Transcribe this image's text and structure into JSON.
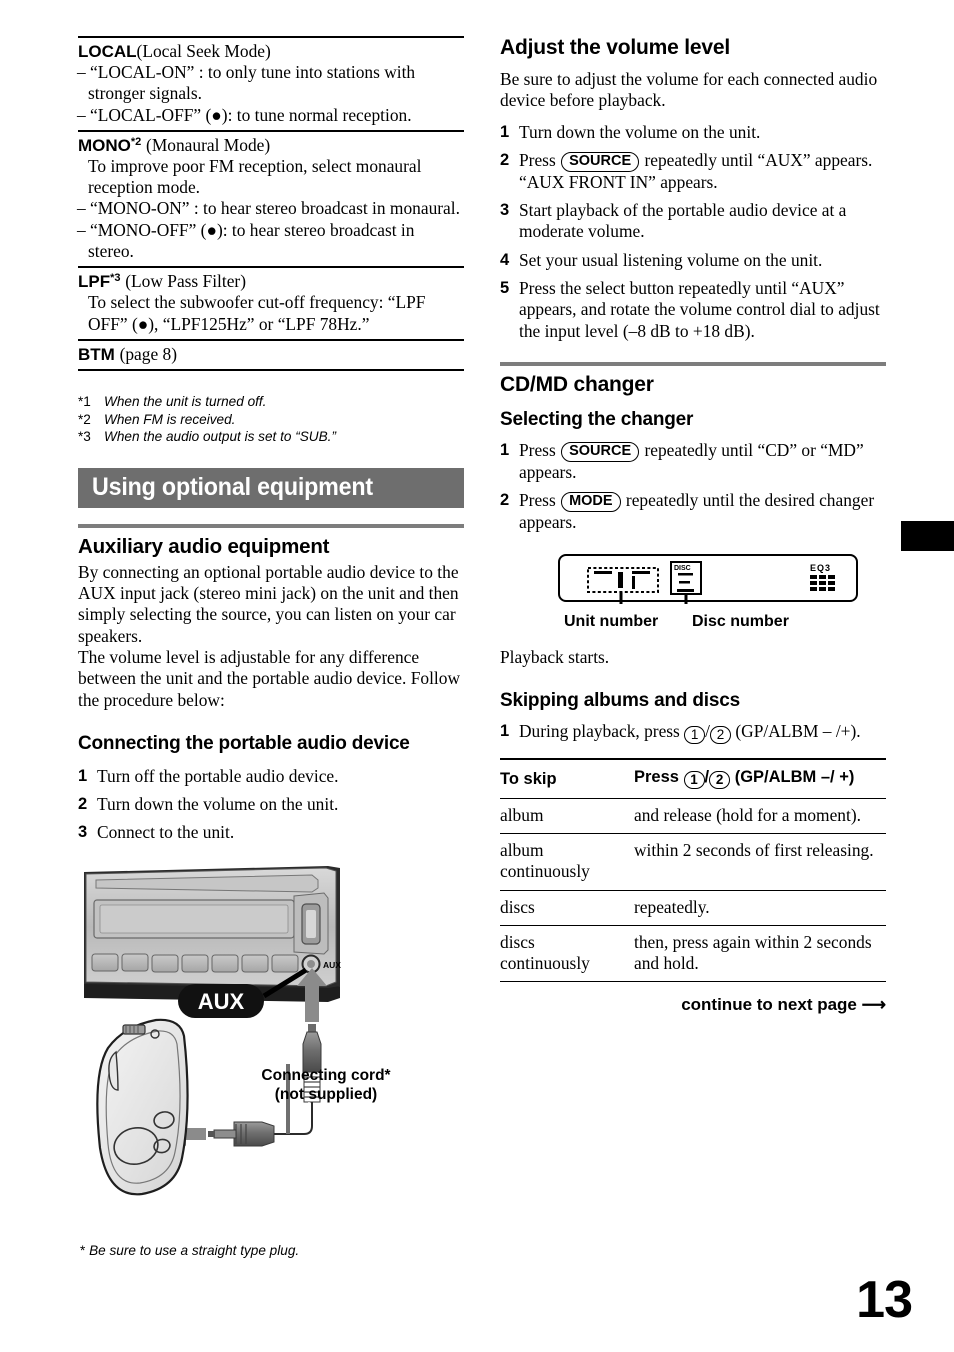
{
  "page_number": "13",
  "left_column": {
    "settings": [
      {
        "name": "LOCAL",
        "sup": "",
        "paren": "(Local Seek Mode)",
        "lines": [
          {
            "type": "dash",
            "text": "– “LOCAL-ON” : to only tune into stations with stronger signals."
          },
          {
            "type": "dash",
            "text": "– “LOCAL-OFF” (●): to tune normal reception."
          }
        ]
      },
      {
        "name": "MONO",
        "sup": "*2",
        "paren": "(Monaural Mode)",
        "lines": [
          {
            "type": "ind",
            "text": "To improve poor FM reception, select monaural reception mode."
          },
          {
            "type": "dash",
            "text": "– “MONO-ON” : to hear stereo broadcast in monaural."
          },
          {
            "type": "dash",
            "text": "– “MONO-OFF” (●): to hear stereo broadcast in stereo."
          }
        ]
      },
      {
        "name": "LPF",
        "sup": "*3",
        "paren": "(Low Pass Filter)",
        "lines": [
          {
            "type": "ind",
            "text": "To select the subwoofer cut-off frequency: “LPF OFF” (●), “LPF125Hz” or “LPF 78Hz.”"
          }
        ]
      },
      {
        "name": "BTM",
        "sup": "",
        "paren": "(page 8)",
        "lines": []
      }
    ],
    "footnotes": [
      {
        "marker": "*1",
        "text": "When the unit is turned off."
      },
      {
        "marker": "*2",
        "text": "When FM is received."
      },
      {
        "marker": "*3",
        "text": "When the audio output is set to “SUB.”"
      }
    ],
    "banner_title": "Using optional equipment",
    "aux_heading": "Auxiliary audio equipment",
    "aux_paragraph_1": "By connecting an optional portable audio device to the AUX input jack (stereo mini jack) on the unit and then simply selecting the source, you can listen on your car speakers.",
    "aux_paragraph_2": "The volume level is adjustable for any difference between the unit and the portable audio device. Follow the procedure below:",
    "connect_heading": "Connecting the portable audio device",
    "connect_steps": [
      {
        "n": "1",
        "text": "Turn off the portable audio device."
      },
      {
        "n": "2",
        "text": "Turn down the volume on the unit."
      },
      {
        "n": "3",
        "text": "Connect to the unit."
      }
    ],
    "figure": {
      "aux_badge": "AUX",
      "aux_port_label": "AUX",
      "cord_label_line1": "Connecting cord*",
      "cord_label_line2": "(not supplied)"
    },
    "bottom_note_marker": "*",
    "bottom_note_text": "Be sure to use a straight type plug."
  },
  "right_column": {
    "volume_heading": "Adjust the volume level",
    "volume_intro": "Be sure to adjust the volume for each connected audio device before playback.",
    "volume_steps": [
      {
        "n": "1",
        "pre": "Turn down the volume on the unit.",
        "key": "",
        "post": ""
      },
      {
        "n": "2",
        "pre": "Press ",
        "key": "SOURCE",
        "post": " repeatedly until “AUX” appears.",
        "extra": "“AUX FRONT IN” appears."
      },
      {
        "n": "3",
        "pre": "Start playback of the portable audio device at a moderate volume.",
        "key": "",
        "post": ""
      },
      {
        "n": "4",
        "pre": "Set your usual listening volume on the unit.",
        "key": "",
        "post": ""
      },
      {
        "n": "5",
        "pre": "Press the select button repeatedly until “AUX” appears, and rotate the volume control dial to adjust the input level (–8 dB to +18 dB).",
        "key": "",
        "post": ""
      }
    ],
    "changer_heading": "CD/MD changer",
    "selecting_heading": "Selecting the changer",
    "selecting_steps": [
      {
        "n": "1",
        "pre": "Press ",
        "key": "SOURCE",
        "post": " repeatedly until “CD” or “MD” appears."
      },
      {
        "n": "2",
        "pre": "Press ",
        "key": "MODE",
        "post": " repeatedly until the desired changer appears."
      }
    ],
    "display_figure": {
      "disc_label": "DISC",
      "eq_label": "EQ3",
      "callout_unit": "Unit number",
      "callout_disc": "Disc number"
    },
    "playback_starts": "Playback starts.",
    "skipping_heading": "Skipping albums and discs",
    "skipping_step": {
      "n": "1",
      "pre": "During playback, press ",
      "k1": "1",
      "sep": "/",
      "k2": "2",
      "post": " (GP/ALBM – /+)."
    },
    "table": {
      "header_col1": "To skip",
      "header_col2_pre": "Press ",
      "header_col2_k1": "1",
      "header_col2_sep": "/",
      "header_col2_k2": "2",
      "header_col2_post": " (GP/ALBM –/ +)",
      "rows": [
        {
          "skip": "album",
          "press": "and release (hold for a moment)."
        },
        {
          "skip": "album continuously",
          "press": "within 2 seconds of first releasing."
        },
        {
          "skip": "discs",
          "press": "repeatedly."
        },
        {
          "skip": "discs continuously",
          "press": "then, press again within 2 seconds and hold."
        }
      ]
    },
    "continue_text": "continue to next page",
    "continue_arrow": "⟶"
  }
}
